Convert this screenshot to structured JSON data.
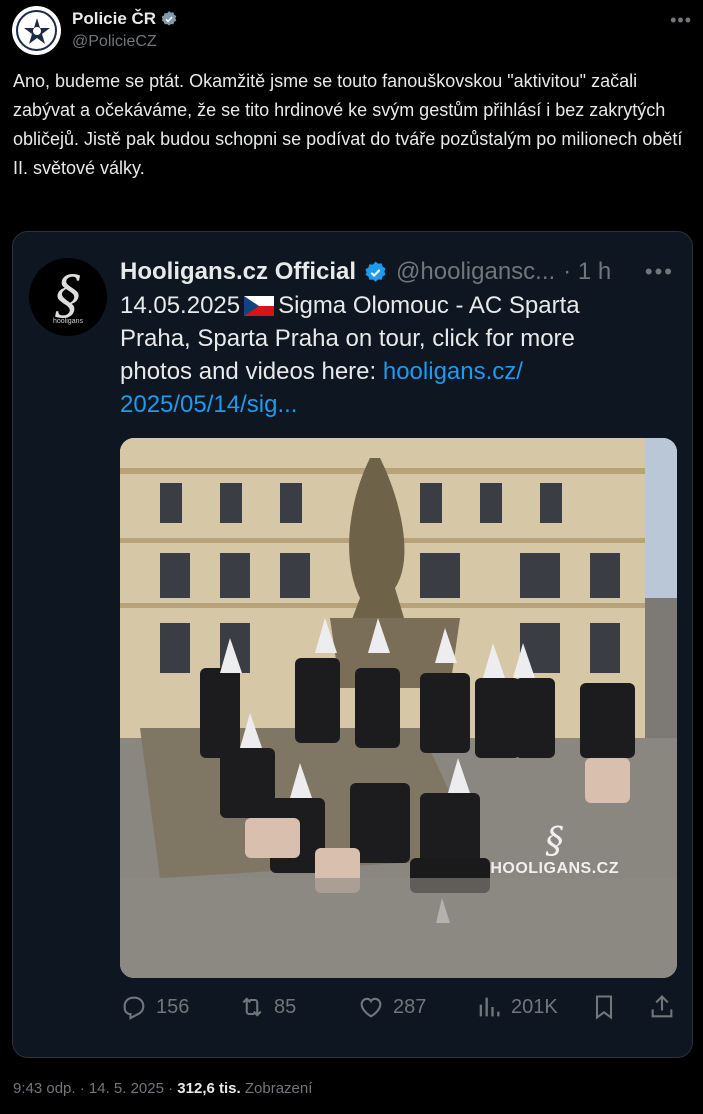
{
  "author": {
    "name": "Policie ČR",
    "handle": "@PolicieCZ"
  },
  "tweet": {
    "text": "Ano, budeme se ptát. Okamžitě jsme se touto fanouškovskou \"aktivitou\" začali zabývat a očekáváme, že se tito hrdinové ke svým gestům přihlásí i bez zakrytých obličejů. Jistě pak budou schopni se podívat do tváře pozůstalým po milionech obětí II. světové války."
  },
  "quote": {
    "name": "Hooligans.cz Official",
    "handle": "@hooligansc...",
    "time": "· 1 h",
    "date": "14.05.2025",
    "text": "Sigma Olomouc - AC Sparta Praha, Sparta Praha on tour, click for more photos and videos here:",
    "link": "hooligans.cz/ 2025/05/14/sig...",
    "avatar_text": "hooligans",
    "watermark": "HOOLIGANS.CZ",
    "actions": {
      "replies": "156",
      "reposts": "85",
      "likes": "287",
      "views": "201K"
    }
  },
  "footer": {
    "time": "9:43 odp. · 14. 5. 2025 ·",
    "views_count": "312,6 tis.",
    "views_label": "Zobrazení"
  },
  "colors": {
    "accent": "#1d9bf0",
    "muted": "#71767b",
    "background": "#000000"
  },
  "icons": [
    "verified-badge-icon",
    "more-icon",
    "reply-icon",
    "repost-icon",
    "like-icon",
    "views-icon",
    "bookmark-icon",
    "share-icon",
    "czech-flag-icon"
  ]
}
